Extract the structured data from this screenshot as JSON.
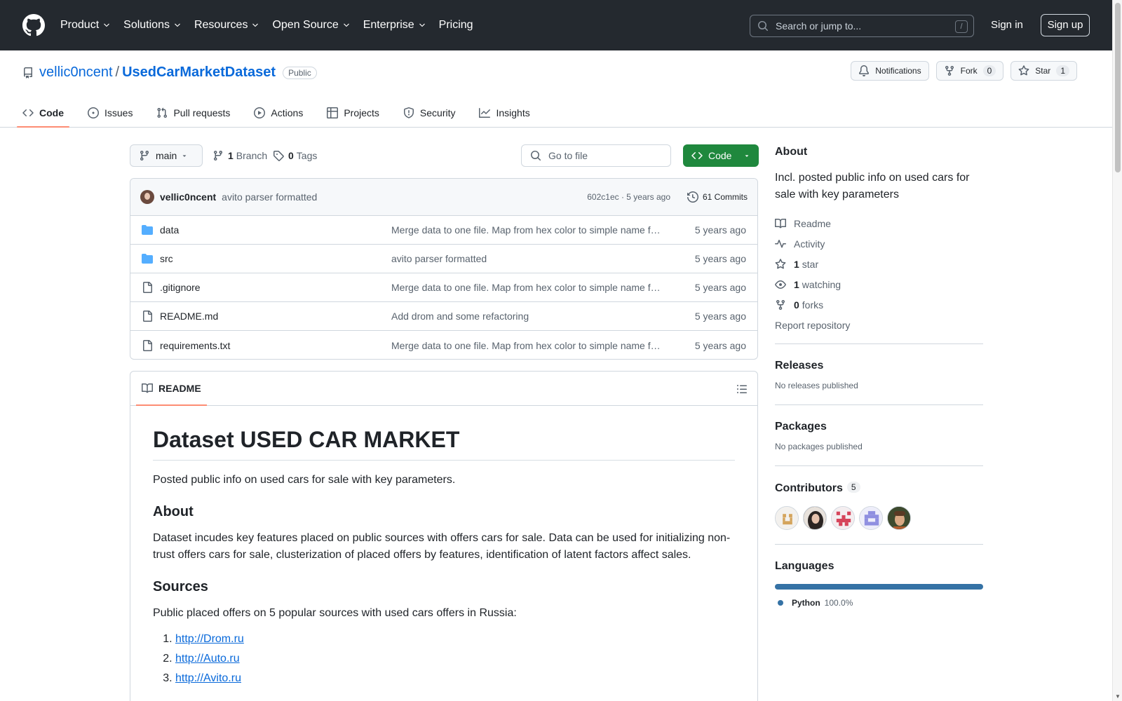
{
  "header": {
    "nav": [
      {
        "label": "Product",
        "has_menu": true
      },
      {
        "label": "Solutions",
        "has_menu": true
      },
      {
        "label": "Resources",
        "has_menu": true
      },
      {
        "label": "Open Source",
        "has_menu": true
      },
      {
        "label": "Enterprise",
        "has_menu": true
      },
      {
        "label": "Pricing",
        "has_menu": false
      }
    ],
    "search_placeholder": "Search or jump to...",
    "search_shortcut": "/",
    "sign_in": "Sign in",
    "sign_up": "Sign up"
  },
  "repo": {
    "owner": "vellic0ncent",
    "separator": "/",
    "name": "UsedCarMarketDataset",
    "visibility": "Public",
    "notifications_label": "Notifications",
    "fork_label": "Fork",
    "fork_count": "0",
    "star_label": "Star",
    "star_count": "1"
  },
  "tabs": [
    {
      "label": "Code",
      "icon": "code-icon",
      "active": true
    },
    {
      "label": "Issues",
      "icon": "issue-icon",
      "active": false
    },
    {
      "label": "Pull requests",
      "icon": "pull-request-icon",
      "active": false
    },
    {
      "label": "Actions",
      "icon": "play-icon",
      "active": false
    },
    {
      "label": "Projects",
      "icon": "table-icon",
      "active": false
    },
    {
      "label": "Security",
      "icon": "shield-icon",
      "active": false
    },
    {
      "label": "Insights",
      "icon": "graph-icon",
      "active": false
    }
  ],
  "toolbar": {
    "branch": "main",
    "branch_count": "1",
    "branch_label": "Branch",
    "tag_count": "0",
    "tag_label": "Tags",
    "goto_placeholder": "Go to file",
    "code_button": "Code"
  },
  "commit": {
    "author": "vellic0ncent",
    "message": "avito parser formatted",
    "hash_time": "602c1ec · 5 years ago",
    "commits_label": "61 Commits"
  },
  "files": [
    {
      "name": "data",
      "type": "folder",
      "message": "Merge data to one file. Map from hex color to simple name f…",
      "date": "5 years ago"
    },
    {
      "name": "src",
      "type": "folder",
      "message": "avito parser formatted",
      "date": "5 years ago"
    },
    {
      "name": ".gitignore",
      "type": "file",
      "message": "Merge data to one file. Map from hex color to simple name f…",
      "date": "5 years ago"
    },
    {
      "name": "README.md",
      "type": "file",
      "message": "Add drom and some refactoring",
      "date": "5 years ago"
    },
    {
      "name": "requirements.txt",
      "type": "file",
      "message": "Merge data to one file. Map from hex color to simple name f…",
      "date": "5 years ago"
    }
  ],
  "readme": {
    "tab_label": "README",
    "title": "Dataset USED CAR MARKET",
    "intro": "Posted public info on used cars for sale with key parameters.",
    "about_heading": "About",
    "about_text": "Dataset incudes key features placed on public sources with offers cars for sale. Data can be used for initializing non-trust offers cars for sale, clusterization of placed offers by features, identification of latent factors affect sales.",
    "sources_heading": "Sources",
    "sources_text": "Public placed offers on 5 popular sources with used cars offers in Russia:",
    "sources": [
      "http://Drom.ru",
      "http://Auto.ru",
      "http://Avito.ru"
    ]
  },
  "sidebar": {
    "about_heading": "About",
    "description": "Incl. posted public info on used cars for sale with key parameters",
    "readme_link": "Readme",
    "activity_link": "Activity",
    "stars_count": "1",
    "stars_label": "star",
    "watching_count": "1",
    "watching_label": "watching",
    "forks_count": "0",
    "forks_label": "forks",
    "report_link": "Report repository",
    "releases_heading": "Releases",
    "releases_text": "No releases published",
    "packages_heading": "Packages",
    "packages_text": "No packages published",
    "contributors_heading": "Contributors",
    "contributors_count": "5",
    "languages_heading": "Languages",
    "languages": [
      {
        "name": "Python",
        "percent": "100.0%",
        "color": "#3572a5",
        "fraction": 1.0
      }
    ]
  },
  "colors": {
    "header_bg": "#24292f",
    "link_blue": "#0969da",
    "code_button_green": "#1f883d",
    "tab_underline": "#fd8c73",
    "folder_blue": "#54aeff",
    "python_blue": "#3572a5"
  }
}
